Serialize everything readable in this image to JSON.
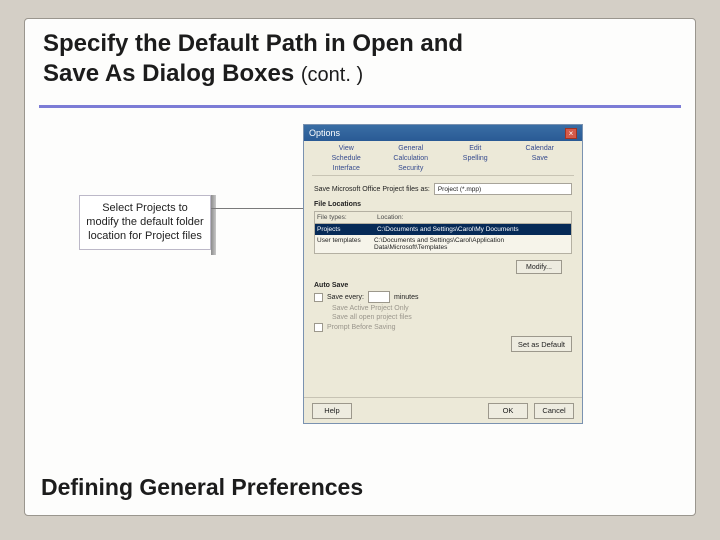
{
  "title_line1": "Specify the Default Path in Open and",
  "title_line2": "Save As Dialog Boxes ",
  "title_cont": "(cont. )",
  "callout": "Select Projects to modify the default folder location for Project files",
  "dialog": {
    "title": "Options",
    "tabs_row1": [
      "View",
      "General",
      "Edit",
      "Calendar"
    ],
    "tabs_row2": [
      "Schedule",
      "Calculation",
      "Spelling",
      "Save"
    ],
    "tabs_row3": [
      "Interface",
      "Security",
      "",
      ""
    ],
    "save_label": "Save Microsoft Office Project files as:",
    "save_value": "Project (*.mpp)",
    "file_loc_header": "File Locations",
    "col1": "File types:",
    "col2": "Location:",
    "row1_c1": "Projects",
    "row1_c2": "C:\\Documents and Settings\\Carol\\My Documents",
    "row2_c1": "User templates",
    "row2_c2": "C:\\Documents and Settings\\Carol\\Application Data\\Microsoft\\Templates",
    "modify": "Modify...",
    "autosave_header": "Auto Save",
    "save_every": "Save every:",
    "minutes": "minutes",
    "opt1": "Save Active Project Only",
    "opt2": "Save all open project files",
    "prompt": "Prompt Before Saving",
    "set_default": "Set as Default",
    "help": "Help",
    "ok": "OK",
    "cancel": "Cancel"
  },
  "footer": "Defining General Preferences"
}
